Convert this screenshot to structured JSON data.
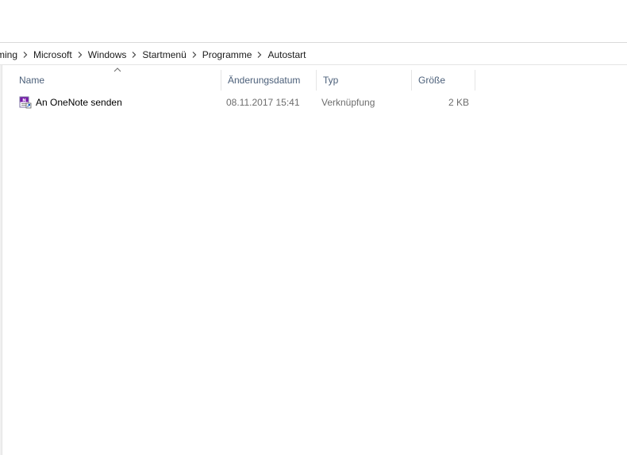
{
  "breadcrumb": {
    "items": [
      "ming",
      "Microsoft",
      "Windows",
      "Startmenü",
      "Programme",
      "Autostart"
    ]
  },
  "columns": {
    "name": "Name",
    "date": "Änderungsdatum",
    "type": "Typ",
    "size": "Größe"
  },
  "files": [
    {
      "name": "An OneNote senden",
      "date": "08.11.2017 15:41",
      "type": "Verknüpfung",
      "size": "2 KB",
      "icon": "onenote-shortcut-icon"
    }
  ],
  "colors": {
    "header_text": "#4c607a",
    "secondary_text": "#6d6d6d",
    "onenote_purple": "#7719aa",
    "hover_blue": "#e5f3ff"
  }
}
